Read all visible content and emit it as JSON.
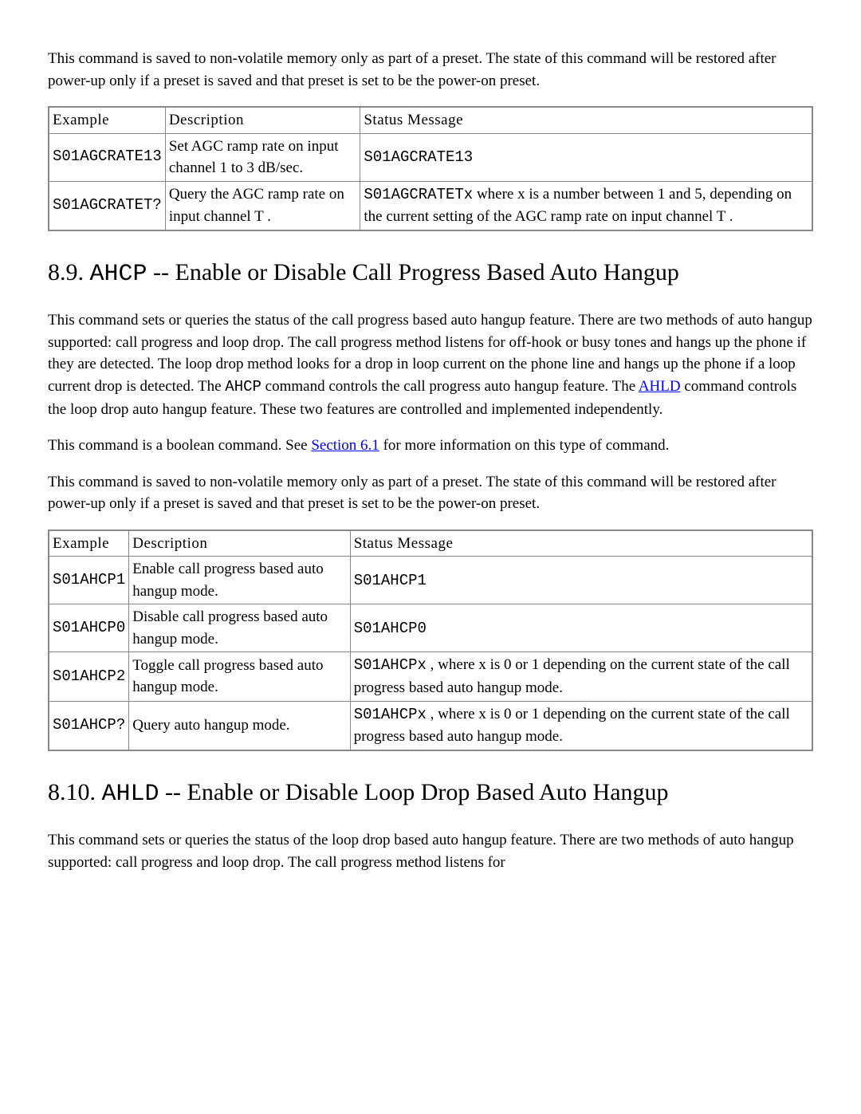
{
  "intro_para": "This command is saved to non-volatile memory only as part of a preset. The state of this command will be restored after power-up only if a preset is saved and that preset is set to be the power-on preset.",
  "table1": {
    "headers": [
      "Example",
      "Description",
      "Status Message"
    ],
    "rows": [
      {
        "example": "S01AGCRATE13",
        "desc": "Set AGC ramp rate on input channel 1 to 3 dB/sec.",
        "status_mono": "S01AGCRATE13",
        "status_text": ""
      },
      {
        "example": "S01AGCRATET?",
        "desc": "Query the AGC ramp rate on input channel T .",
        "status_mono": "S01AGCRATETx",
        "status_text": " where x is a number between 1 and 5, depending on the current setting of the AGC ramp rate on input channel T ."
      }
    ]
  },
  "sec89": {
    "number": "8.9. ",
    "code": "AHCP",
    "rest": " -- Enable or Disable Call Progress Based Auto Hangup",
    "para1_a": "This command sets or queries the status of the call progress based auto hangup feature. There are two methods of auto hangup supported: call progress and loop drop. The call progress method listens for off-hook or busy tones and hangs up the phone if they are detected. The loop drop method looks for a drop in loop current on the phone line and hangs up the phone if a loop current drop is detected. The ",
    "para1_code": "AHCP",
    "para1_b": " command controls the call progress auto hangup feature. The ",
    "para1_link": "AHLD",
    "para1_c": " command controls the loop drop auto hangup feature. These two features are controlled and implemented independently.",
    "para2_a": "This command is a boolean command. See ",
    "para2_link": "Section 6.1",
    "para2_b": " for more information on this type of command.",
    "para3": "This command is saved to non-volatile memory only as part of a preset. The state of this command will be restored after power-up only if a preset is saved and that preset is set to be the power-on preset."
  },
  "table2": {
    "headers": [
      "Example",
      "Description",
      "Status Message"
    ],
    "rows": [
      {
        "example": "S01AHCP1",
        "desc": "Enable call progress based auto hangup mode.",
        "status_mono": "S01AHCP1",
        "status_text": ""
      },
      {
        "example": "S01AHCP0",
        "desc": "Disable call progress based auto hangup mode.",
        "status_mono": "S01AHCP0",
        "status_text": ""
      },
      {
        "example": "S01AHCP2",
        "desc": "Toggle call progress based auto hangup mode.",
        "status_mono": "S01AHCPx",
        "status_text": " , where x is 0 or 1 depending on the current state of the call progress based auto hangup mode."
      },
      {
        "example": "S01AHCP?",
        "desc": "Query auto hangup mode.",
        "status_mono": "S01AHCPx",
        "status_text": " , where x is 0 or 1 depending on the current state of the call progress based auto hangup mode."
      }
    ]
  },
  "sec810": {
    "number": "8.10. ",
    "code": "AHLD",
    "rest": " -- Enable or Disable Loop Drop Based Auto Hangup",
    "para1": "This command sets or queries the status of the loop drop based auto hangup feature. There are two methods of auto hangup supported: call progress and loop drop. The call progress method listens for"
  }
}
